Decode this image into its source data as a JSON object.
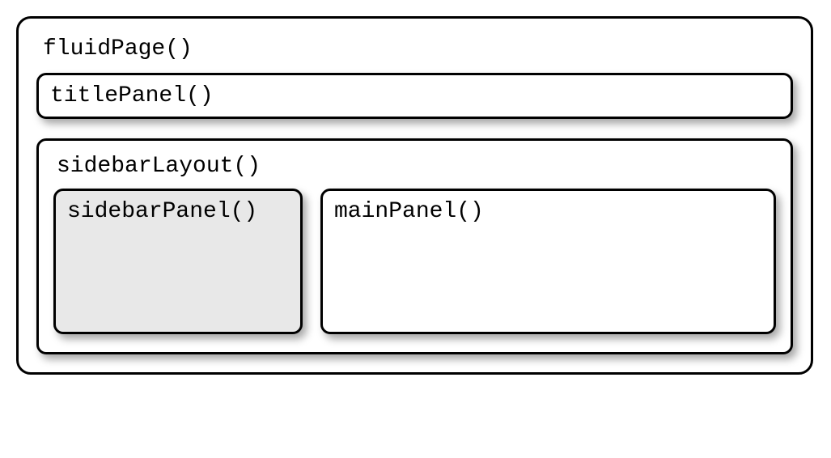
{
  "fluidPage": {
    "label": "fluidPage()",
    "titlePanel": {
      "label": "titlePanel()"
    },
    "sidebarLayout": {
      "label": "sidebarLayout()",
      "sidebarPanel": {
        "label": "sidebarPanel()"
      },
      "mainPanel": {
        "label": "mainPanel()"
      }
    }
  }
}
